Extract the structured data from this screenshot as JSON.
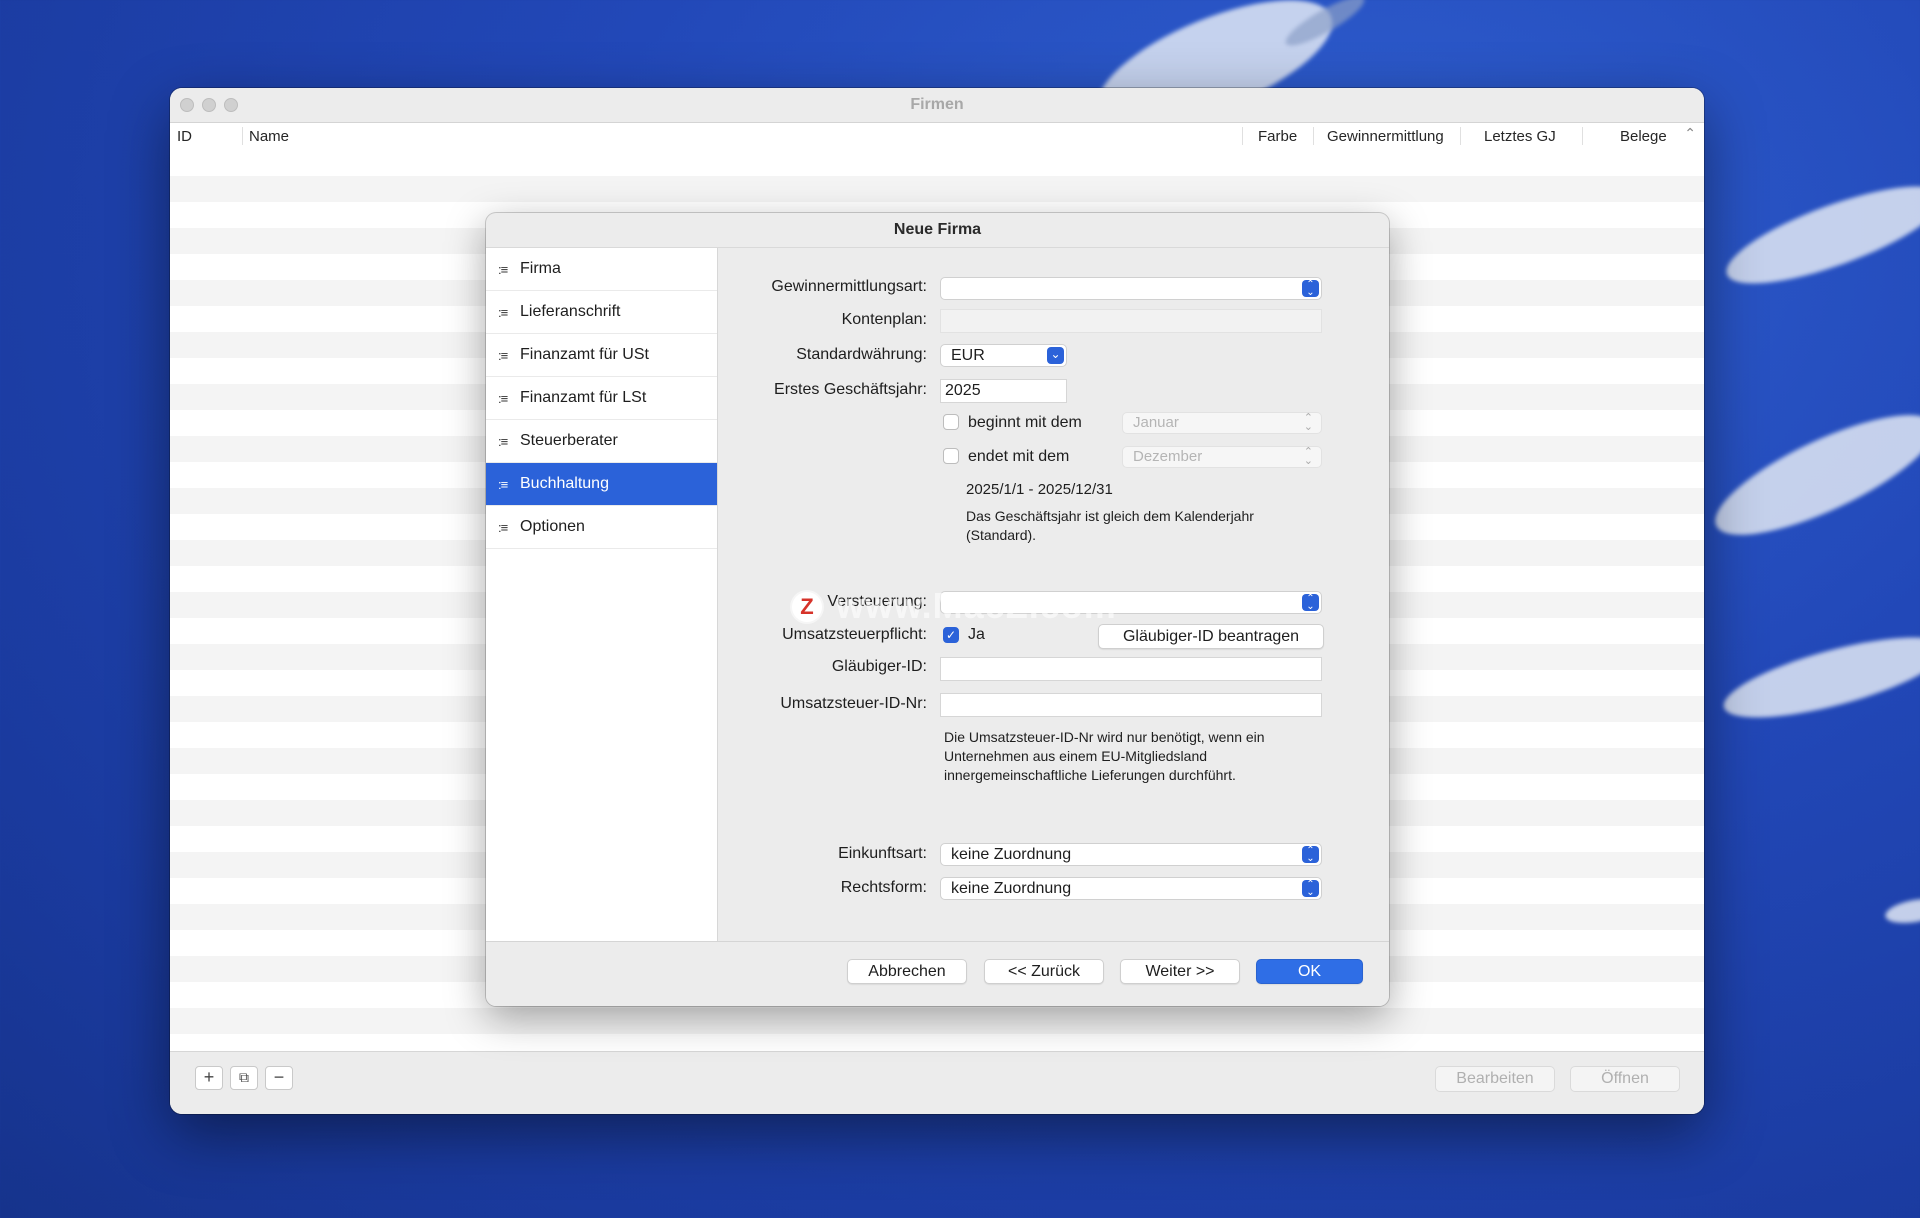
{
  "window": {
    "title": "Firmen",
    "columns": [
      "ID",
      "Name",
      "Farbe",
      "Gewinnermittlung",
      "Letztes GJ",
      "Belege"
    ],
    "bottom_buttons": {
      "add": "+",
      "duplicate": "⧉",
      "remove": "−",
      "edit": "Bearbeiten",
      "open": "Öffnen"
    }
  },
  "dialog": {
    "title": "Neue Firma",
    "sidebar": [
      {
        "label": "Firma"
      },
      {
        "label": "Lieferanschrift"
      },
      {
        "label": "Finanzamt für USt"
      },
      {
        "label": "Finanzamt für LSt"
      },
      {
        "label": "Steuerberater"
      },
      {
        "label": "Buchhaltung",
        "active": true
      },
      {
        "label": "Optionen"
      }
    ],
    "form": {
      "gewinnermittlungsart_label": "Gewinnermittlungsart:",
      "gewinnermittlungsart_value": "",
      "kontenplan_label": "Kontenplan:",
      "kontenplan_value": "",
      "standardwaehrung_label": "Standardwährung:",
      "standardwaehrung_value": "EUR",
      "erstes_gj_label": "Erstes Geschäftsjahr:",
      "erstes_gj_value": "2025",
      "beginnt_label": "beginnt mit dem",
      "beginnt_month": "Januar",
      "endet_label": "endet mit dem",
      "endet_month": "Dezember",
      "period": "2025/1/1 - 2025/12/31",
      "period_note": "Das Geschäftsjahr ist gleich dem Kalenderjahr (Standard).",
      "versteuerung_label": "Versteuerung:",
      "versteuerung_value": "",
      "ust_pflicht_label": "Umsatzsteuerpflicht:",
      "ust_pflicht_checkbox": "Ja",
      "glaeubiger_button": "Gläubiger-ID beantragen",
      "glaeubiger_label": "Gläubiger-ID:",
      "glaeubiger_value": "",
      "ust_id_label": "Umsatzsteuer-ID-Nr:",
      "ust_id_value": "",
      "ust_id_note": "Die Umsatzsteuer-ID-Nr wird nur benötigt, wenn ein Unternehmen aus einem EU-Mitgliedsland innergemeinschaftliche Lieferungen durchführt.",
      "einkunftsart_label": "Einkunftsart:",
      "einkunftsart_value": "keine Zuordnung",
      "rechtsform_label": "Rechtsform:",
      "rechtsform_value": "keine Zuordnung"
    },
    "buttons": {
      "cancel": "Abbrechen",
      "back": "<< Zurück",
      "next": "Weiter >>",
      "ok": "OK"
    }
  },
  "watermark": {
    "logo": "Z",
    "text": "www.MacZ.com"
  }
}
